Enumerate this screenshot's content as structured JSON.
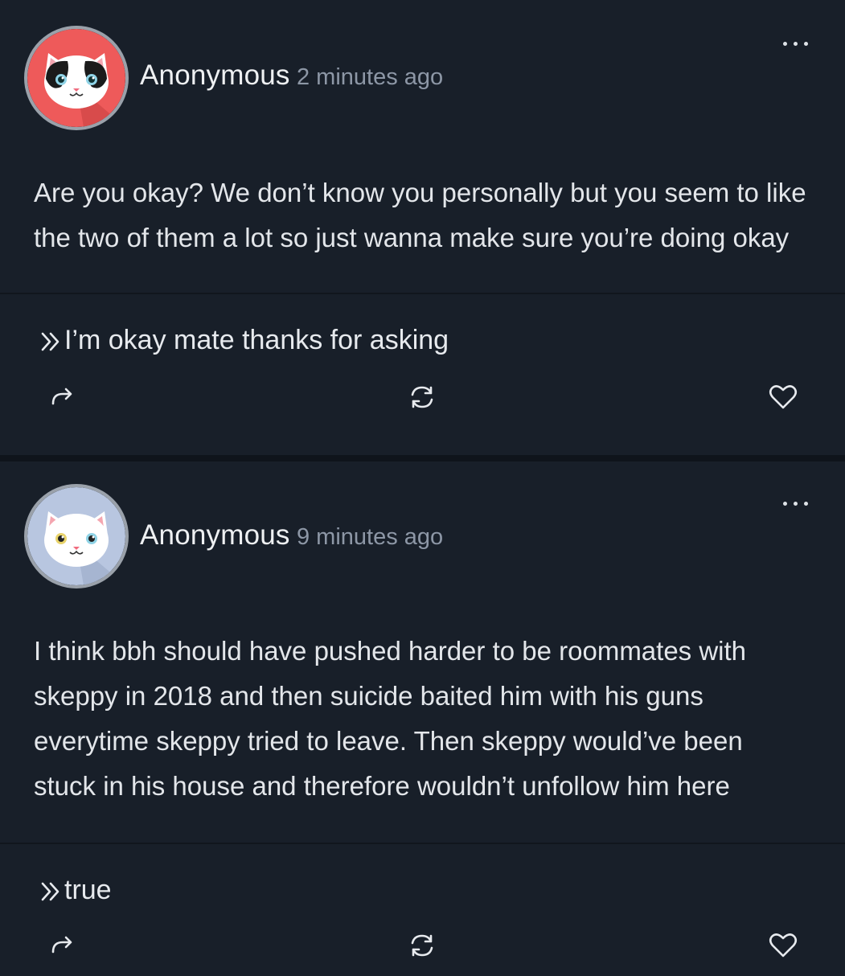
{
  "posts": [
    {
      "author": "Anonymous",
      "time": "2 minutes ago",
      "question_lines": [
        "Are you okay? We don’t know you personally but you seem to like",
        "the two of them a lot so just wanna make sure you’re doing okay"
      ],
      "answer": "I’m okay mate thanks for asking",
      "avatar": {
        "background": "#ee5a5a",
        "icon": "black-white-cat-avatar"
      }
    },
    {
      "author": "Anonymous",
      "time": "9 minutes ago",
      "question_lines": [
        "I think bbh should have pushed harder to be roommates with",
        "skeppy in 2018 and then suicide baited him with his guns",
        "everytime skeppy tried to leave. Then skeppy would’ve been",
        "stuck in his house and therefore wouldn’t unfollow him here"
      ],
      "answer": "true",
      "avatar": {
        "background": "#b8c6e0",
        "icon": "white-cat-avatar"
      }
    }
  ],
  "icons": {
    "more": "more-dots-icon",
    "answer_marker": "double-chevron-right-icon",
    "share": "share-arrow-icon",
    "repost": "refresh-icon",
    "like": "heart-icon"
  },
  "colors": {
    "background": "#181f29",
    "text": "#e3e6ea",
    "muted": "#8d97a6"
  }
}
